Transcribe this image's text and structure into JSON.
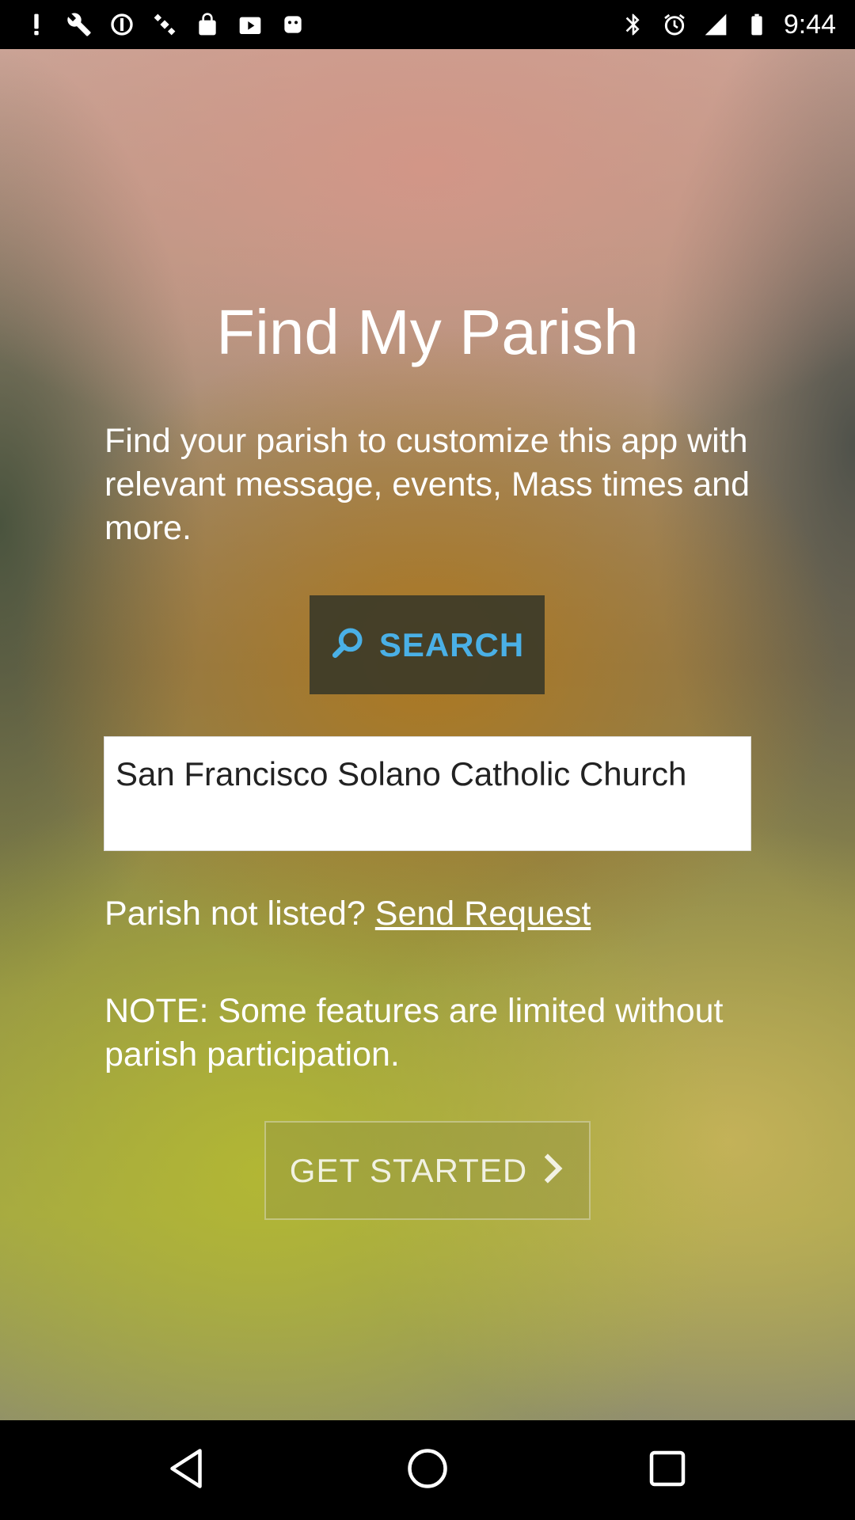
{
  "status_bar": {
    "time": "9:44",
    "left_icons": [
      "alert-icon",
      "wrench-icon",
      "data-saver-icon",
      "satellite-icon",
      "lock-icon",
      "play-store-icon",
      "android-icon"
    ],
    "right_icons": [
      "bluetooth-icon",
      "alarm-icon",
      "signal-icon",
      "battery-icon"
    ]
  },
  "screen": {
    "title": "Find My Parish",
    "intro": "Find your parish to customize this app with relevant message, events, Mass times and more.",
    "search_label": "SEARCH",
    "selected_parish": "San Francisco Solano Catholic Church",
    "not_listed_prefix": "Parish not listed? ",
    "send_request_label": "Send Request",
    "note": "NOTE: Some features are limited without parish participation.",
    "get_started_label": "GET STARTED"
  },
  "colors": {
    "search_accent": "#4ab0e6",
    "text": "#ffffff"
  },
  "nav_bar": {
    "buttons": [
      "back-icon",
      "home-icon",
      "recents-icon"
    ]
  }
}
